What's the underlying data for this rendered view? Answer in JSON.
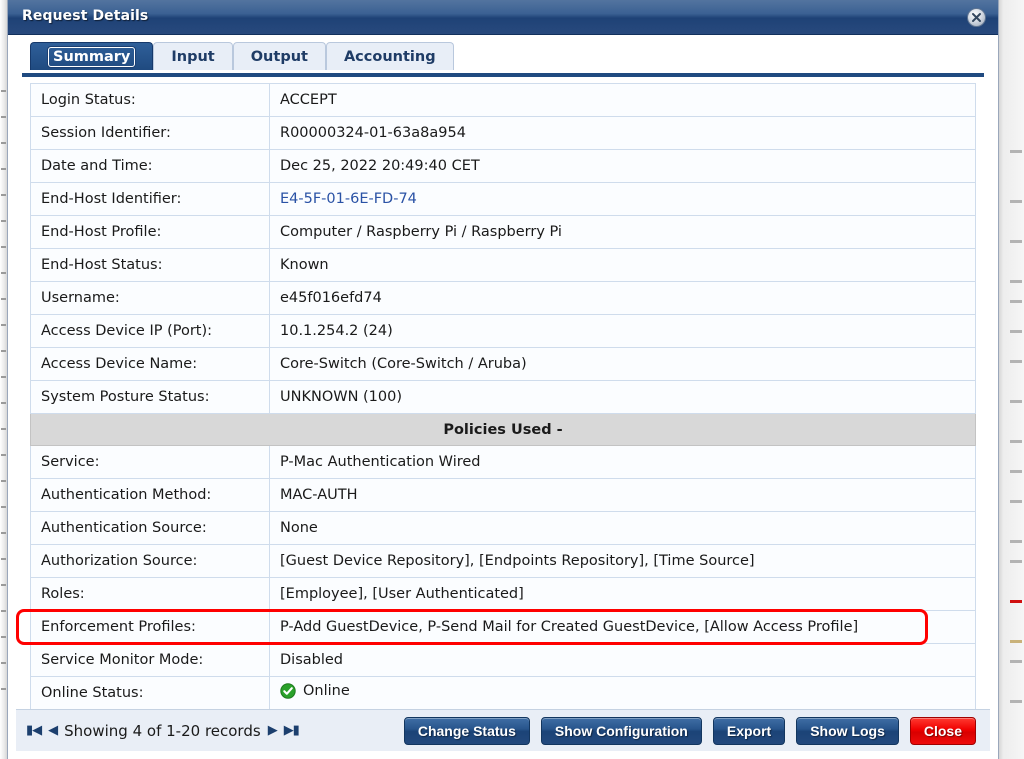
{
  "window": {
    "title": "Request Details",
    "close_icon": "close-icon"
  },
  "tabs": [
    {
      "label": "Summary",
      "active": true
    },
    {
      "label": "Input",
      "active": false
    },
    {
      "label": "Output",
      "active": false
    },
    {
      "label": "Accounting",
      "active": false
    }
  ],
  "summary_rows": [
    {
      "key": "Login Status:",
      "value": "ACCEPT",
      "style": "plain"
    },
    {
      "key": "Session Identifier:",
      "value": "R00000324-01-63a8a954",
      "style": "plain"
    },
    {
      "key": "Date and Time:",
      "value": "Dec 25, 2022 20:49:40 CET",
      "style": "plain"
    },
    {
      "key": "End-Host Identifier:",
      "value": "E4-5F-01-6E-FD-74",
      "style": "link"
    },
    {
      "key": "End-Host Profile:",
      "value": "Computer / Raspberry Pi / Raspberry Pi",
      "style": "plain"
    },
    {
      "key": "End-Host Status:",
      "value": "Known",
      "style": "plain"
    },
    {
      "key": "Username:",
      "value": "e45f016efd74",
      "style": "plain"
    },
    {
      "key": "Access Device IP (Port):",
      "value": "10.1.254.2 (24)",
      "style": "plain"
    },
    {
      "key": "Access Device Name:",
      "value": "Core-Switch (Core-Switch / Aruba)",
      "style": "plain"
    },
    {
      "key": "System Posture Status:",
      "value": "UNKNOWN (100)",
      "style": "plain"
    }
  ],
  "section_header": "Policies Used -",
  "policy_rows": [
    {
      "key": "Service:",
      "value": "P-Mac Authentication Wired",
      "style": "plain"
    },
    {
      "key": "Authentication Method:",
      "value": "MAC-AUTH",
      "style": "plain"
    },
    {
      "key": "Authentication Source:",
      "value": "None",
      "style": "plain"
    },
    {
      "key": "Authorization Source:",
      "value": "[Guest Device Repository], [Endpoints Repository], [Time Source]",
      "style": "plain"
    },
    {
      "key": "Roles:",
      "value": "[Employee], [User Authenticated]",
      "style": "plain"
    },
    {
      "key": "Enforcement Profiles:",
      "value": "P-Add GuestDevice, P-Send Mail for Created GuestDevice, [Allow Access Profile]",
      "style": "plain",
      "highlighted": true
    },
    {
      "key": "Service Monitor Mode:",
      "value": "Disabled",
      "style": "plain"
    },
    {
      "key": "Online Status:",
      "value": "Online",
      "style": "status-online",
      "status_icon": "check-circle-icon"
    }
  ],
  "footer": {
    "pager": {
      "first_icon": "first-page-icon",
      "prev_icon": "previous-page-icon",
      "text": "Showing 4 of 1-20 records",
      "next_icon": "next-page-icon",
      "last_icon": "last-page-icon"
    },
    "buttons": [
      {
        "label": "Change Status",
        "kind": "primary"
      },
      {
        "label": "Show Configuration",
        "kind": "primary"
      },
      {
        "label": "Export",
        "kind": "primary"
      },
      {
        "label": "Show Logs",
        "kind": "primary"
      },
      {
        "label": "Close",
        "kind": "danger"
      }
    ]
  },
  "colors": {
    "titlebar": "#1e4276",
    "accent": "#1f4a80",
    "highlight": "#ff0000",
    "online": "#2aa12a",
    "link": "#2a52a5",
    "section_bg": "#d8d8d8",
    "footer_bg": "#e9eef6"
  }
}
